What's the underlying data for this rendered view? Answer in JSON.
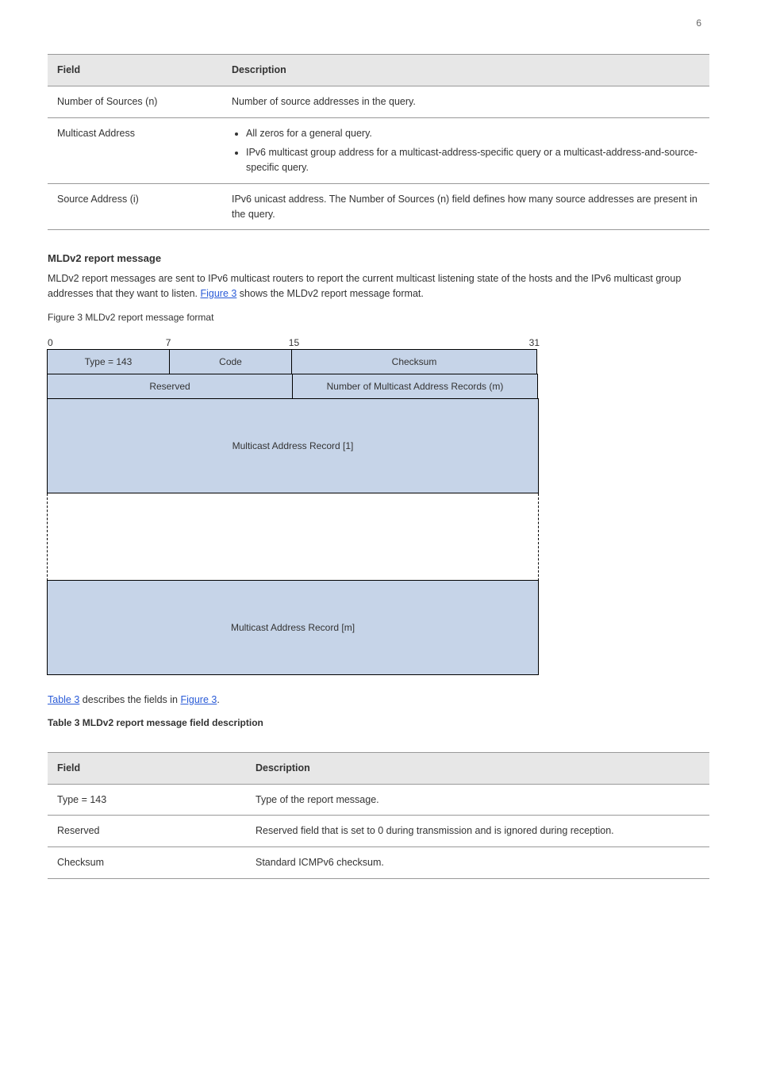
{
  "page_number": "6",
  "table1": {
    "headers": {
      "field": "Field",
      "desc": "Description"
    },
    "rows": [
      {
        "field": "Number of Sources (n)",
        "desc": "Number of source addresses in the query."
      },
      {
        "field": "Multicast Address",
        "bullets": [
          "All zeros for a general query.",
          "IPv6 multicast group address for a multicast-address-specific query or a multicast-address-and-source-specific query."
        ]
      },
      {
        "field": "Source Address (i)",
        "desc": "IPv6 unicast address. The Number of Sources (n) field defines how many source addresses are present in the query."
      }
    ]
  },
  "section": {
    "heading": "MLDv2 report message",
    "para1_prefix": "MLDv2 report messages are sent to IPv6 multicast routers to report the current multicast listening state of the hosts and the IPv6 multicast group addresses that they want to listen. ",
    "para1_link": "Figure 3",
    "para1_suffix": " shows the MLDv2 report message format.",
    "fig_label": "Figure 3 MLDv2 report message format",
    "para2_link1": "Table 3",
    "para2_mid": " describes the fields in ",
    "para2_link2": "Figure 3",
    "para2_end": ".",
    "table2_caption": "Table 3 MLDv2 report message field description"
  },
  "chart_data": {
    "type": "table",
    "bit_markers": [
      "0",
      "7",
      "15",
      "31"
    ],
    "rows": [
      [
        "Type = 143",
        "Code",
        "Checksum"
      ],
      [
        "Reserved",
        "Number of Multicast Address Records (m)"
      ],
      [
        "Multicast Address Record [1]"
      ],
      [
        "..."
      ],
      [
        "Multicast Address Record [m]"
      ]
    ],
    "col_widths_bits": {
      "row0": [
        8,
        8,
        16
      ],
      "row1": [
        16,
        16
      ],
      "row2": [
        32
      ],
      "row4": [
        32
      ]
    }
  },
  "table2": {
    "headers": {
      "field": "Field",
      "desc": "Description"
    },
    "rows": [
      {
        "field": "Type = 143",
        "desc": "Type of the report message."
      },
      {
        "field": "Reserved",
        "desc": "Reserved field that is set to 0 during transmission and is ignored during reception."
      },
      {
        "field": "Checksum",
        "desc": "Standard ICMPv6 checksum."
      }
    ]
  }
}
